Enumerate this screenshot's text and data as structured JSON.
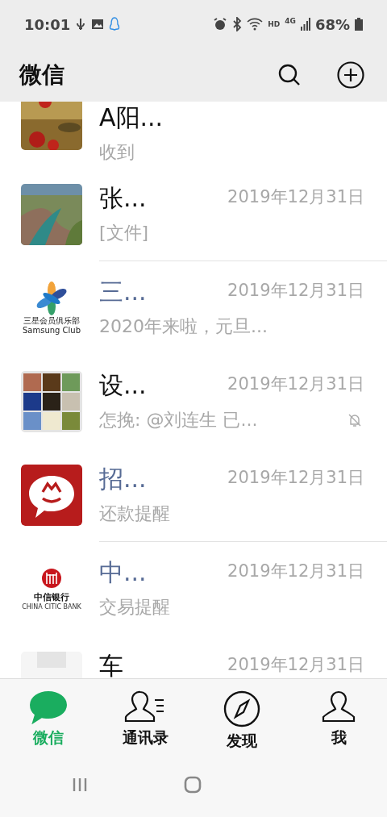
{
  "status_bar": {
    "time": "10:01",
    "network": "HD",
    "signal_type": "4G",
    "battery": "68%"
  },
  "header": {
    "title": "微信"
  },
  "chats": [
    {
      "title": "A阳...",
      "kind": "person",
      "preview": "收到",
      "muted": false
    },
    {
      "title": "张...",
      "kind": "person",
      "date": "2019年12月31日",
      "preview": "[文件]",
      "muted": false
    },
    {
      "title": "三...",
      "kind": "official",
      "date": "2019年12月31日",
      "preview": "2020年来啦，元旦...",
      "muted": false,
      "avatar": {
        "kind": "flower-logo",
        "lines": [
          "三星会员俱乐部",
          "Samsung Club"
        ]
      }
    },
    {
      "title": "设...",
      "kind": "person",
      "date": "2019年12月31日",
      "preview": "怎挽: @刘连生 已...",
      "muted": true
    },
    {
      "title": "招...",
      "kind": "official",
      "date": "2019年12月31日",
      "preview": "还款提醒",
      "muted": false,
      "avatar": {
        "kind": "bubble-logo"
      }
    },
    {
      "title": "中...",
      "kind": "official",
      "date": "2019年12月31日",
      "preview": "交易提醒",
      "muted": false,
      "avatar": {
        "kind": "bank-logo",
        "lines": [
          "中信银行",
          "CHINA CITIC BANK"
        ]
      }
    },
    {
      "title": "车",
      "kind": "person",
      "date": "2019年12月31日",
      "muted": false
    }
  ],
  "tabs": [
    {
      "label": "微信",
      "selected": true
    },
    {
      "label": "通讯录",
      "selected": false
    },
    {
      "label": "发现",
      "selected": false
    },
    {
      "label": "我",
      "selected": false
    }
  ]
}
